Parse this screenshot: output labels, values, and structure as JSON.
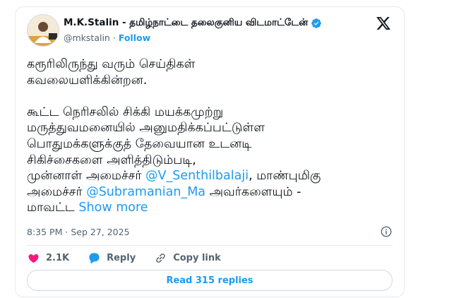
{
  "author": {
    "display_name": "M.K.Stalin - தமிழ்நாட்டை தலைகுனிய விடமாட்டேன்",
    "handle": "@mkstalin",
    "separator": "·",
    "follow_label": "Follow",
    "verified": true,
    "avatar_icon": "profile-photo"
  },
  "tweet": {
    "line1": "கரூரிலிருந்து வரும் செய்திகள்",
    "line2": "கவலையளிக்கின்றன.",
    "line3": "கூட்ட நெரிசலில் சிக்கி மயக்கமுற்று",
    "line4": "மருத்துவமனையில் அனுமதிக்கப்பட்டுள்ள",
    "line5": "பொதுமக்களுக்குத் தேவையான உடனடி",
    "line6": "சிகிச்சைகளை அளித்திடும்படி,",
    "line7_prefix": "முன்னாள் அமைச்சர் ",
    "mention1": "@V_Senthilbalaji",
    "line7_suffix": ", மாண்புமிகு",
    "line8_prefix": "அமைச்சர் ",
    "mention2": "@Subramanian_Ma",
    "line8_suffix": " அவர்களையும் -",
    "line9_prefix": "மாவட்ட ",
    "show_more": "Show more"
  },
  "meta": {
    "time": "8:35 PM",
    "separator": "·",
    "date": "Sep 27, 2025"
  },
  "actions": {
    "like_count": "2.1K",
    "reply_label": "Reply",
    "copy_link_label": "Copy link"
  },
  "read_replies_label": "Read 315 replies",
  "colors": {
    "accent": "#1d9bf0",
    "like": "#f91880",
    "text": "#0f1419",
    "muted": "#536471"
  }
}
